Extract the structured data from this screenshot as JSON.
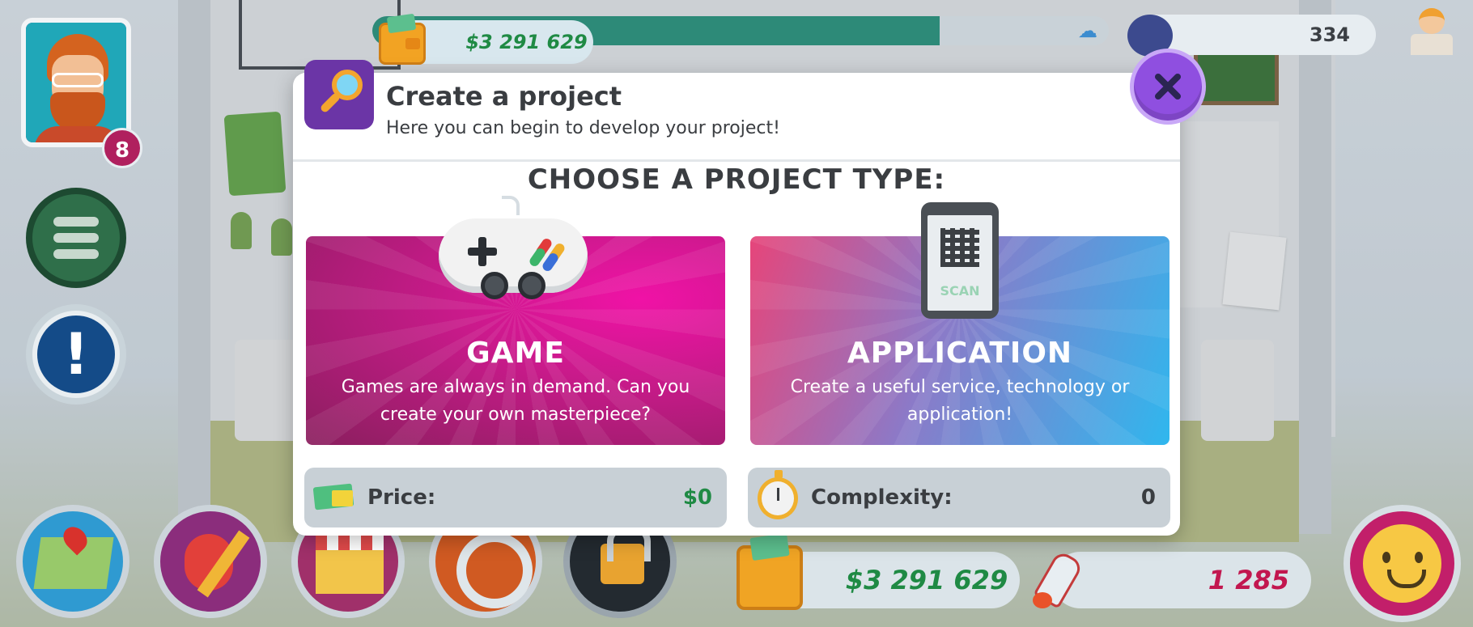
{
  "hud": {
    "money": "$3 291 629",
    "fans": "334",
    "level": "8",
    "money_progress": 0.77
  },
  "bottom_bar": {
    "money": "$3 291 629",
    "fans": "1 285"
  },
  "modal": {
    "title": "Create a project",
    "subtitle": "Here you can begin to develop your project!",
    "heading": "CHOOSE A PROJECT TYPE:",
    "cards": [
      {
        "title": "GAME",
        "description": "Games are always in demand. Can you create your own masterpiece?"
      },
      {
        "title": "APPLICATION",
        "description": "Create a useful service, technology or application!",
        "phone_screen_text": "SCAN"
      }
    ],
    "price": {
      "label": "Price:",
      "value": "$0",
      "icon": "cash-icon"
    },
    "complexity": {
      "label": "Complexity:",
      "value": "0",
      "icon": "stopwatch-icon"
    }
  },
  "colors": {
    "money_green": "#1f8a44",
    "fans_red": "#c2174f",
    "price_value": "#1f8a44",
    "complexity_value": "#3a3d41",
    "close_button": "#8f4fe0"
  }
}
